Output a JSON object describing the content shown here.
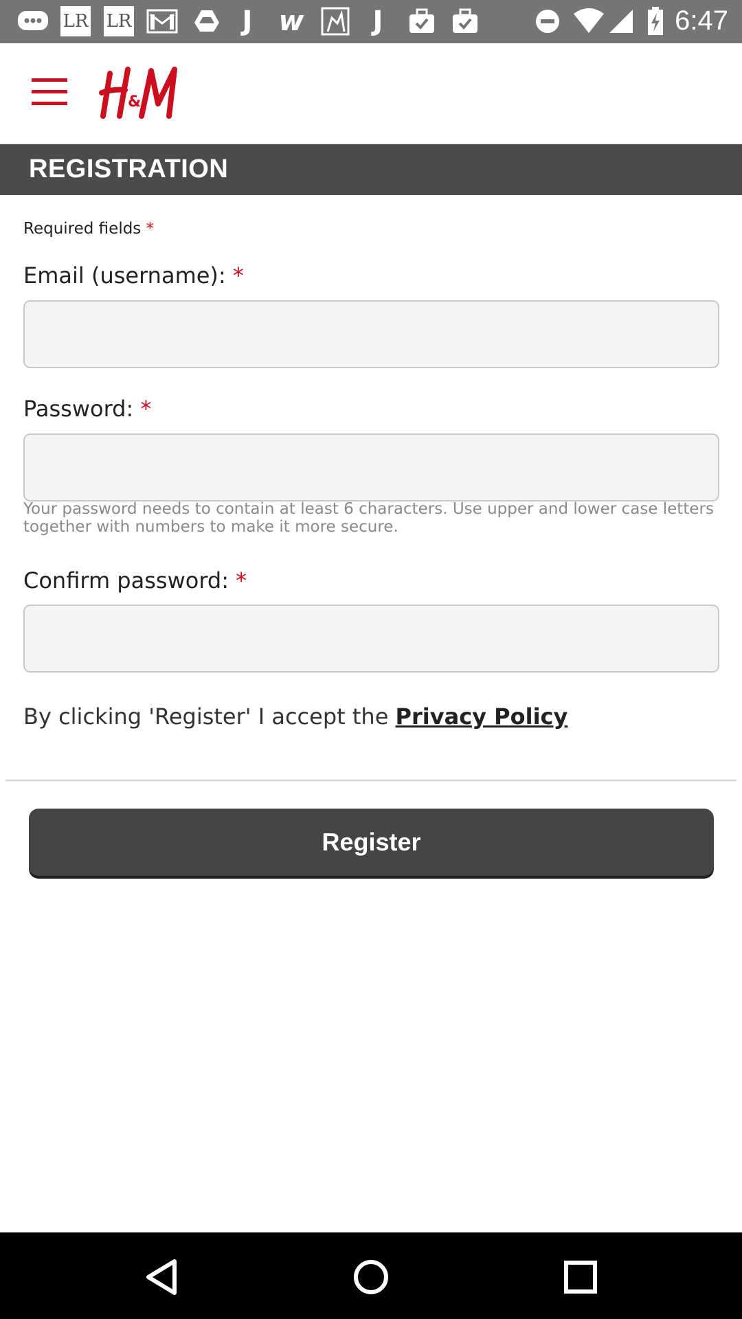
{
  "status_bar": {
    "time": "6:47",
    "notification_icons": [
      "chat-bubble-icon",
      "lr-icon",
      "lr-icon",
      "gmail-icon",
      "drive-icon",
      "j-icon",
      "w-icon",
      "image-icon",
      "j-icon",
      "briefcase-check-icon",
      "briefcase-check-icon"
    ],
    "lr_text": "LR",
    "system_icons": [
      "do-not-disturb-icon",
      "wifi-icon",
      "signal-icon",
      "battery-charging-icon"
    ]
  },
  "header": {
    "logo_text": "H&M",
    "brand_color": "#cc0f1e"
  },
  "page": {
    "title": "REGISTRATION"
  },
  "form": {
    "required_note": "Required fields",
    "required_marker": "*",
    "email_label": "Email (username):",
    "email_value": "",
    "password_label": "Password:",
    "password_value": "",
    "password_hint": "Your password needs to contain at least 6 characters. Use upper and lower case letters together with numbers to make it more secure.",
    "confirm_label": "Confirm password:",
    "confirm_value": "",
    "policy_text": "By clicking 'Register' I accept the ",
    "policy_link": "Privacy Policy",
    "register_label": "Register"
  },
  "nav_bar": {
    "buttons": [
      "back-icon",
      "home-icon",
      "recents-icon"
    ]
  }
}
